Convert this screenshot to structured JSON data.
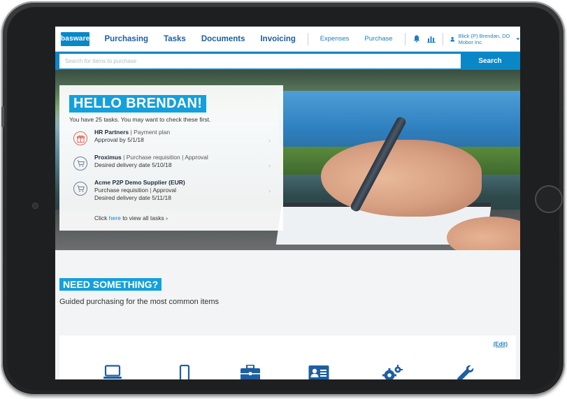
{
  "nav": {
    "logo": "basware",
    "main": [
      "Purchasing",
      "Tasks",
      "Documents",
      "Invoicing"
    ],
    "secondary": [
      "Expenses",
      "Purchase"
    ],
    "user": "Blick (P) Brendan, DO Mobor Inc."
  },
  "search": {
    "placeholder": "Search for items to purchase",
    "button": "Search"
  },
  "hero": {
    "greeting": "HELLO BRENDAN!",
    "intro": "You have 25 tasks. You may want to check these first.",
    "tasks": [
      {
        "name": "HR Partners",
        "type": "Payment plan",
        "line2": "Approval by 5/1/18",
        "icon": "gift-icon",
        "color": "#e26a5a"
      },
      {
        "name": "Proximus",
        "type": "Purchase requisition",
        "status": "Approval",
        "line2": "Desired delivery date 5/10/18",
        "icon": "cart-icon",
        "color": "#6c7f93"
      },
      {
        "name": "Acme P2P Demo Supplier (EUR)",
        "line2": "Purchase requisition",
        "status": "Approval",
        "line3": "Desired delivery date 5/11/18",
        "icon": "cart-icon",
        "color": "#6c7f93"
      }
    ],
    "view_all_prefix": "Click",
    "view_all_link": "here",
    "view_all_suffix": "to view all tasks ›"
  },
  "need": {
    "title": "NEED SOMETHING?",
    "subtitle": "Guided purchasing for the most common items",
    "edit": "(Edit)",
    "categories": [
      "laptop-icon",
      "phone-icon",
      "briefcase-icon",
      "id-card-icon",
      "gears-icon",
      "wrench-icon"
    ]
  },
  "colors": {
    "accent": "#0a87c7",
    "highlight": "#14a0dc",
    "nav_text": "#1d5fa0"
  }
}
